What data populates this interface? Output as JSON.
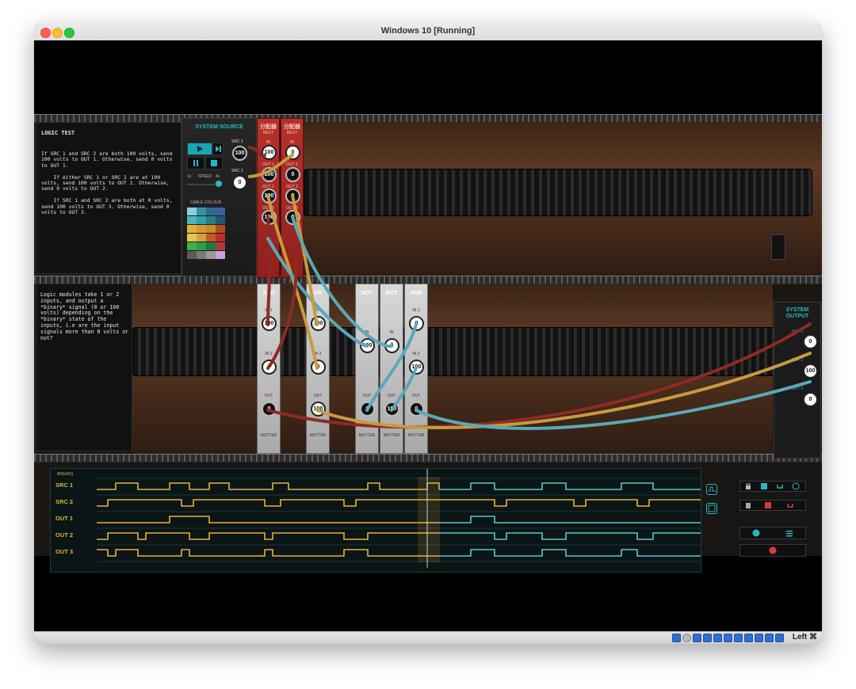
{
  "window": {
    "title": "Windows 10 [Running]"
  },
  "status_bar": {
    "host_key": "Left ⌘"
  },
  "logic_test": {
    "title": "LOGIC TEST",
    "text": "If SRC 1 and SRC 2 are both 100 volts, send 100 volts to OUT 1. Otherwise, send 0 volts to OUT 1.\n\n    If either SRC 1 or SRC 2 are at 100 volts, send 100 volts to OUT 2. Otherwise, send 0 volts to OUT 2.\n\n    If SRC 1 and SRC 2 are both at 0 volts, send 100 volts to OUT 3. Otherwise, send 0 volts to OUT 3."
  },
  "hint": {
    "text": "Logic modules take 1 or 2 inputs, and output a *binary* signal (0 or 100 volts) depending on the *binary* state of the inputs, i.e are the input signals more than 0 volts or not?"
  },
  "system_source": {
    "title": "SYSTEM SOURCE",
    "speed_min": "1x",
    "speed_label": "SPEED",
    "speed_max": "4x",
    "cable_colour": "CABLE COLOUR",
    "src1_label": "SRC 1",
    "src1_value": "100",
    "src2_label": "SRC 2",
    "src2_value": "0"
  },
  "cable_swatches": [
    "#8bd0d8",
    "#3a8fa0",
    "#2a6b8c",
    "#3f5f9a",
    "#44b8c0",
    "#2aa2b1",
    "#2b7b8a",
    "#1d5970",
    "#e3b13a",
    "#d49b2e",
    "#c98a2a",
    "#b7471f",
    "#e6c45a",
    "#d6a03f",
    "#c8572c",
    "#b8302d",
    "#3fb04a",
    "#2f9e49",
    "#1d7d3d",
    "#b03a3a",
    "#5a5a5a",
    "#7a7a7a",
    "#9a9a9a",
    "#c9a0dc"
  ],
  "multiples": [
    {
      "title": "分配器",
      "sub": "MULT",
      "in": "100",
      "outs": [
        "100",
        "100",
        "100"
      ]
    },
    {
      "title": "分配器",
      "sub": "MULT",
      "in": "0",
      "outs": [
        "0",
        "0",
        "0"
      ]
    }
  ],
  "mult_labels": {
    "in": "IN",
    "out1": "OUT 1",
    "out2": "OUT 2",
    "out3": "OUT 3"
  },
  "logic_modules": [
    {
      "title": "AND",
      "in1": "100",
      "in2": "0",
      "out": "0"
    },
    {
      "title": "OR",
      "in1": "100",
      "in2": "0",
      "out": "100"
    },
    {
      "title": "NOT",
      "in": "100",
      "out": "0"
    },
    {
      "title": "NOT",
      "in": "0",
      "out": "100"
    },
    {
      "title": "AND",
      "in1": "0",
      "in2": "100",
      "out": "0"
    }
  ],
  "module_labels": {
    "in1": "IN 1",
    "in2": "IN 2",
    "in": "IN",
    "out": "OUT",
    "brand": "MUTTER"
  },
  "system_output": {
    "title_line1": "SYSTEM",
    "title_line2": "OUTPUT",
    "outputs": [
      {
        "label": "OUT 1",
        "value": "0"
      },
      {
        "label": "OUT 2",
        "value": "100"
      },
      {
        "label": "OUT 3",
        "value": "0"
      }
    ]
  },
  "timeline": {
    "breaks_label": "BREAKS",
    "rows": [
      "SRC 1",
      "SRC 2",
      "OUT 1",
      "OUT 2",
      "OUT 3"
    ]
  },
  "colors": {
    "accent": "#2ab7c4",
    "signal_yellow": "#e8b13b",
    "cable_red": "#8e2a24",
    "cable_yellow": "#c89a3f",
    "cable_cyan": "#5aa8b8"
  }
}
